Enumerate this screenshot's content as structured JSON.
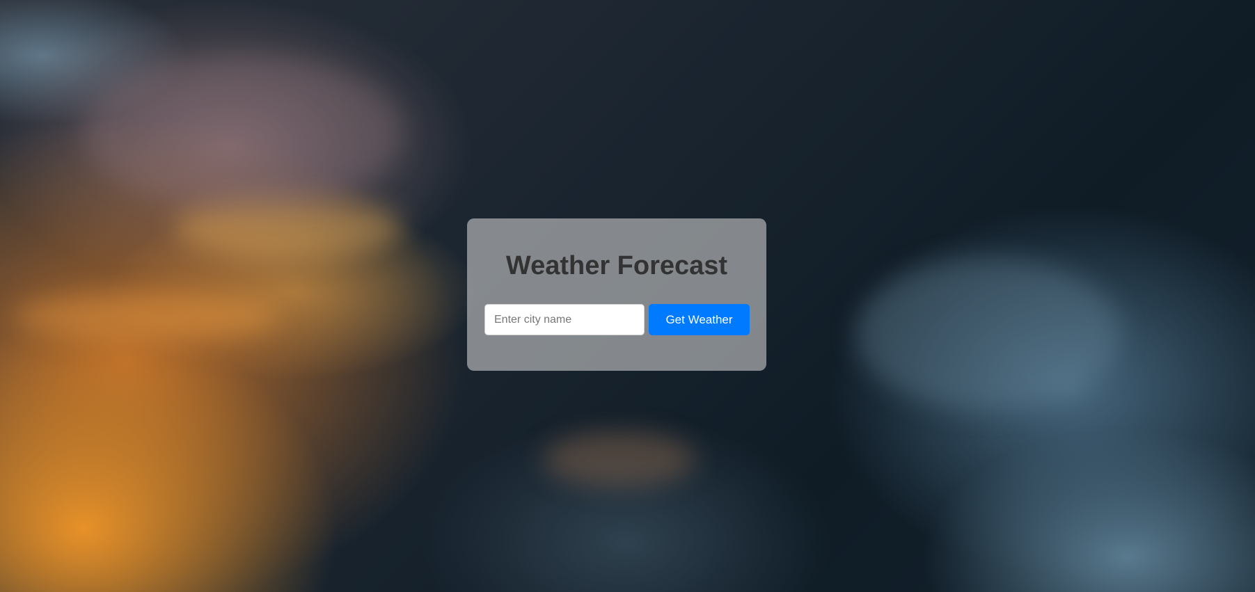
{
  "app": {
    "title": "Weather Forecast"
  },
  "search": {
    "placeholder": "Enter city name",
    "value": "",
    "button_label": "Get Weather"
  },
  "colors": {
    "button_background": "#007bff",
    "button_text": "#ffffff",
    "title_text": "#333333"
  }
}
